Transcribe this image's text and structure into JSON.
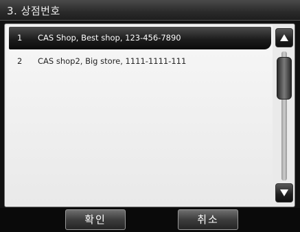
{
  "window": {
    "title": "3. 상점번호"
  },
  "list": {
    "items": [
      {
        "index": "1",
        "text": "CAS Shop, Best shop, 123-456-7890",
        "selected": true
      },
      {
        "index": "2",
        "text": "CAS shop2, Big store, 1111-1111-111",
        "selected": false
      }
    ]
  },
  "scrollbar": {
    "up_icon": "triangle-up-icon",
    "down_icon": "triangle-down-icon"
  },
  "buttons": {
    "ok_label": "확인",
    "cancel_label": "취소"
  },
  "colors": {
    "selected_row": "#1d1d1d",
    "list_background": "#f0f0f0",
    "title_bar": "#2a2a2a"
  }
}
